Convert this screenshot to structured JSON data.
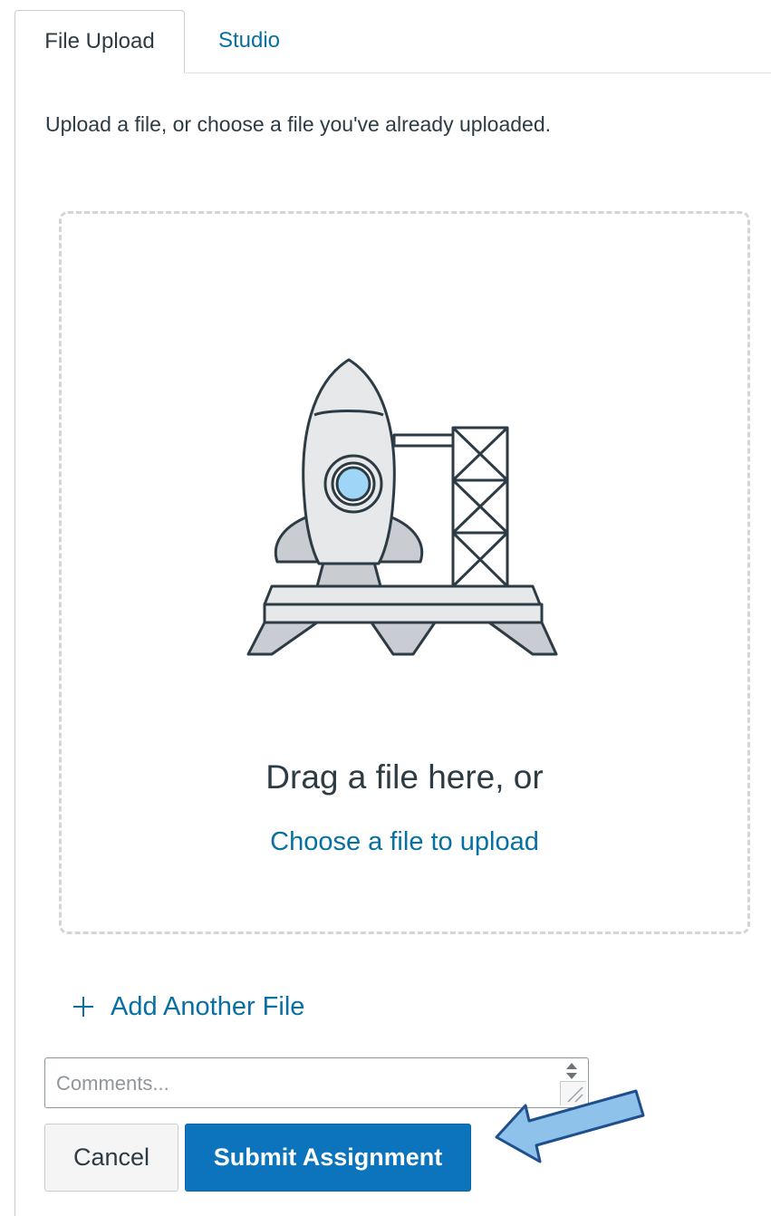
{
  "tabs": [
    {
      "label": "File Upload",
      "active": true
    },
    {
      "label": "Studio",
      "active": false
    }
  ],
  "upload": {
    "instructions": "Upload a file, or choose a file you've already uploaded.",
    "drag_text": "Drag a file here, or",
    "choose_link": "Choose a file to upload",
    "illustration": "rocket-launch-icon"
  },
  "add_file": {
    "label": "Add Another File",
    "icon": "plus-icon"
  },
  "comments": {
    "placeholder": "Comments..."
  },
  "buttons": {
    "cancel": "Cancel",
    "submit": "Submit Assignment"
  },
  "colors": {
    "link": "#0770a3",
    "primary_button": "#0b74bd",
    "text": "#2d3b45",
    "annotation_arrow": "#8ec2ea"
  }
}
